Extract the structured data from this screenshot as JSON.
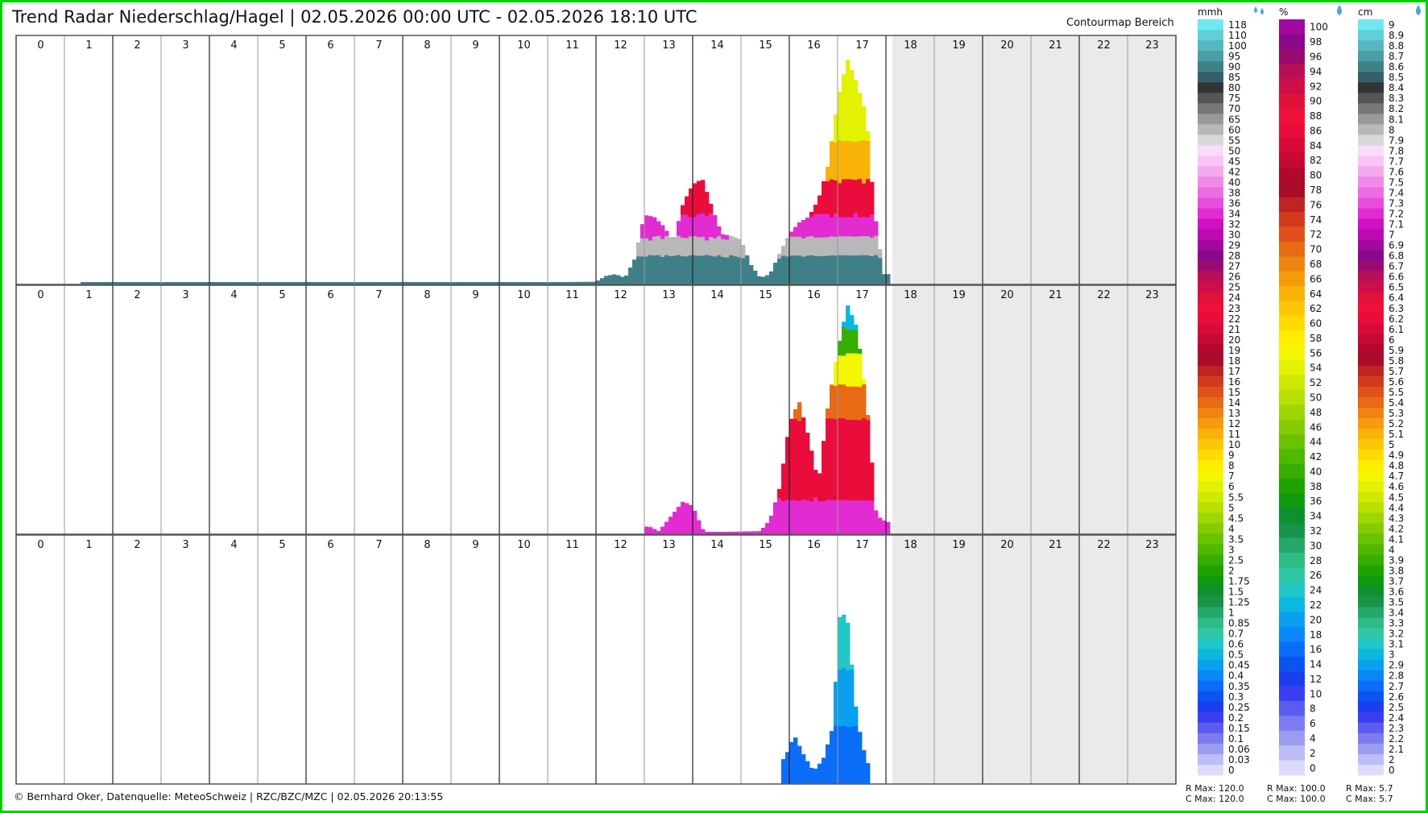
{
  "header": {
    "title": "Trend Radar Niederschlag/Hagel | 02.05.2026 00:00 UTC - 02.05.2026 18:10 UTC",
    "contour_label": "Contourmap Bereich"
  },
  "footer": {
    "text": "© Bernhard Oker, Datenquelle: MeteoSchweiz | RZC/BZC/MZC | 02.05.2026 20:13:55"
  },
  "colors": {
    "frame": "#00d000",
    "future_shading": "#eaeaea",
    "hour_line_dark": "#222222",
    "hour_line_light": "#999999"
  },
  "chart_data": {
    "type": "heatmap",
    "hours": [
      "0",
      "1",
      "2",
      "3",
      "4",
      "5",
      "6",
      "7",
      "8",
      "9",
      "10",
      "11",
      "12",
      "13",
      "14",
      "15",
      "16",
      "17",
      "18",
      "19",
      "20",
      "21",
      "22",
      "23"
    ],
    "current_time": "18:10",
    "panels": [
      {
        "name": "RZC",
        "unit": "mmh",
        "ymax": 120,
        "profile": [
          [
            1.45,
            0.5
          ],
          [
            1.7,
            0.5
          ],
          [
            2.3,
            0.3
          ],
          [
            4.5,
            0.4
          ],
          [
            4.75,
            0.4
          ],
          [
            6.2,
            0.4
          ],
          [
            9.35,
            0.4
          ],
          [
            9.75,
            0.4
          ],
          [
            12.0,
            1
          ],
          [
            12.2,
            4
          ],
          [
            12.4,
            5
          ],
          [
            12.6,
            3
          ],
          [
            12.8,
            13
          ],
          [
            13.0,
            36
          ],
          [
            13.2,
            35
          ],
          [
            13.4,
            30
          ],
          [
            13.6,
            22
          ],
          [
            13.8,
            42
          ],
          [
            14.0,
            52
          ],
          [
            14.2,
            55
          ],
          [
            14.4,
            40
          ],
          [
            14.6,
            26
          ],
          [
            14.8,
            25
          ],
          [
            15.0,
            23
          ],
          [
            15.2,
            10
          ],
          [
            15.4,
            3
          ],
          [
            15.6,
            5
          ],
          [
            15.8,
            16
          ],
          [
            16.0,
            26
          ],
          [
            16.2,
            32
          ],
          [
            16.4,
            35
          ],
          [
            16.6,
            44
          ],
          [
            16.8,
            62
          ],
          [
            17.0,
            96
          ],
          [
            17.2,
            118
          ],
          [
            17.4,
            105
          ],
          [
            17.6,
            88
          ],
          [
            17.75,
            40
          ],
          [
            17.95,
            5
          ]
        ]
      },
      {
        "name": "BZC",
        "unit": "percent",
        "ymax": 100,
        "profile": [
          [
            13.1,
            3
          ],
          [
            13.3,
            1
          ],
          [
            13.8,
            14
          ],
          [
            14.0,
            12
          ],
          [
            14.2,
            2
          ],
          [
            14.3,
            0.5
          ],
          [
            15.4,
            1
          ],
          [
            15.6,
            6
          ],
          [
            15.8,
            20
          ],
          [
            16.0,
            48
          ],
          [
            16.2,
            58
          ],
          [
            16.4,
            42
          ],
          [
            16.6,
            22
          ],
          [
            16.8,
            56
          ],
          [
            17.0,
            80
          ],
          [
            17.2,
            100
          ],
          [
            17.4,
            90
          ],
          [
            17.6,
            58
          ],
          [
            17.8,
            8
          ],
          [
            18.0,
            5
          ]
        ]
      },
      {
        "name": "MZC",
        "unit": "cm",
        "ymax": 5.7,
        "profile": [
          [
            15.9,
            0.6
          ],
          [
            16.1,
            1.2
          ],
          [
            16.3,
            0.7
          ],
          [
            16.5,
            0.3
          ],
          [
            16.7,
            0.6
          ],
          [
            16.9,
            1.4
          ],
          [
            17.05,
            4.3
          ],
          [
            17.2,
            4.1
          ],
          [
            17.4,
            1.6
          ],
          [
            17.6,
            0.5
          ]
        ]
      }
    ],
    "legends": [
      {
        "unit": "mmh",
        "header": "mmh",
        "icon": "rain-drops-icon",
        "labels": [
          "118",
          "110",
          "100",
          "95",
          "90",
          "85",
          "80",
          "75",
          "70",
          "65",
          "60",
          "55",
          "50",
          "45",
          "42",
          "40",
          "38",
          "36",
          "34",
          "32",
          "30",
          "29",
          "28",
          "27",
          "26",
          "25",
          "24",
          "23",
          "22",
          "21",
          "20",
          "19",
          "18",
          "17",
          "16",
          "15",
          "14",
          "13",
          "12",
          "11",
          "10",
          "9",
          "8",
          "7",
          "6",
          "5.5",
          "5",
          "4.5",
          "4",
          "3.5",
          "3",
          "2.5",
          "2",
          "1.75",
          "1.5",
          "1.25",
          "1",
          "0.85",
          "0.7",
          "0.6",
          "0.5",
          "0.45",
          "0.4",
          "0.35",
          "0.3",
          "0.25",
          "0.2",
          "0.15",
          "0.1",
          "0.06",
          "0.03",
          "0"
        ],
        "footer_r": "R Max: 120.0",
        "footer_c": "C Max: 120.0"
      },
      {
        "unit": "percent",
        "header": "%",
        "icon": "drop-icon",
        "labels": [
          "100",
          "98",
          "96",
          "94",
          "92",
          "90",
          "88",
          "86",
          "84",
          "82",
          "80",
          "78",
          "76",
          "74",
          "72",
          "70",
          "68",
          "66",
          "64",
          "62",
          "60",
          "58",
          "56",
          "54",
          "52",
          "50",
          "48",
          "46",
          "44",
          "42",
          "40",
          "38",
          "36",
          "34",
          "32",
          "30",
          "28",
          "26",
          "24",
          "22",
          "20",
          "18",
          "16",
          "14",
          "12",
          "10",
          "8",
          "6",
          "4",
          "2",
          "0"
        ],
        "footer_r": "R Max: 100.0",
        "footer_c": "C Max: 100.0"
      },
      {
        "unit": "cm",
        "header": "cm",
        "icon": "drop-icon",
        "labels": [
          "9",
          "8.9",
          "8.8",
          "8.7",
          "8.6",
          "8.5",
          "8.4",
          "8.3",
          "8.2",
          "8.1",
          "8",
          "7.9",
          "7.8",
          "7.7",
          "7.6",
          "7.5",
          "7.4",
          "7.3",
          "7.2",
          "7.1",
          "7",
          "6.9",
          "6.8",
          "6.7",
          "6.6",
          "6.5",
          "6.4",
          "6.3",
          "6.2",
          "6.1",
          "6",
          "5.9",
          "5.8",
          "5.7",
          "5.6",
          "5.5",
          "5.4",
          "5.3",
          "5.2",
          "5.1",
          "5",
          "4.9",
          "4.8",
          "4.7",
          "4.6",
          "4.5",
          "4.4",
          "4.3",
          "4.2",
          "4.1",
          "4",
          "3.9",
          "3.8",
          "3.7",
          "3.6",
          "3.5",
          "3.4",
          "3.3",
          "3.2",
          "3.1",
          "3",
          "2.9",
          "2.8",
          "2.7",
          "2.6",
          "2.5",
          "2.4",
          "2.3",
          "2.2",
          "2.1",
          "2",
          "0"
        ],
        "footer_r": "R Max: 5.7",
        "footer_c": "C Max: 5.7"
      }
    ],
    "legend_colors": [
      "#8ff8ff",
      "#70e8f0",
      "#5fd0d8",
      "#55b8c0",
      "#4a9ea5",
      "#3f8088",
      "#35606a",
      "#333333",
      "#555555",
      "#777777",
      "#999999",
      "#b8b8b8",
      "#d8d8d8",
      "#f8dcf8",
      "#f7c4f5",
      "#f4a8f0",
      "#f08ae8",
      "#ec6ce2",
      "#e84ddb",
      "#e22cd2",
      "#d10fc6",
      "#bb0ab4",
      "#a308a0",
      "#88078a",
      "#9a0a6f",
      "#b80f58",
      "#cc0f48",
      "#e0123c",
      "#f0103a",
      "#ea0d3c",
      "#d80b38",
      "#c40934",
      "#b0082e",
      "#a80c28",
      "#bd2422",
      "#d23a1e",
      "#e0501a",
      "#e86a14",
      "#ef8410",
      "#f59c0c",
      "#f9b208",
      "#fcc804",
      "#ffdc00",
      "#fdee00",
      "#f4f700",
      "#e2f200",
      "#cfea00",
      "#b8e000",
      "#9ed600",
      "#84cc00",
      "#6ac200",
      "#50b800",
      "#36ad00",
      "#1fa300",
      "#0f9a10",
      "#108f2e",
      "#19944a",
      "#25a868",
      "#2ebc85",
      "#30c8a4",
      "#22c8c8",
      "#0ab8e0",
      "#0aa0f0",
      "#0a88f8",
      "#0a6ef8",
      "#0a55f0",
      "#1a3ef0",
      "#3a3ef0",
      "#5a5cf0",
      "#7a7cf0",
      "#9a9cf2",
      "#bcbcf6",
      "#dcdcfa"
    ]
  }
}
